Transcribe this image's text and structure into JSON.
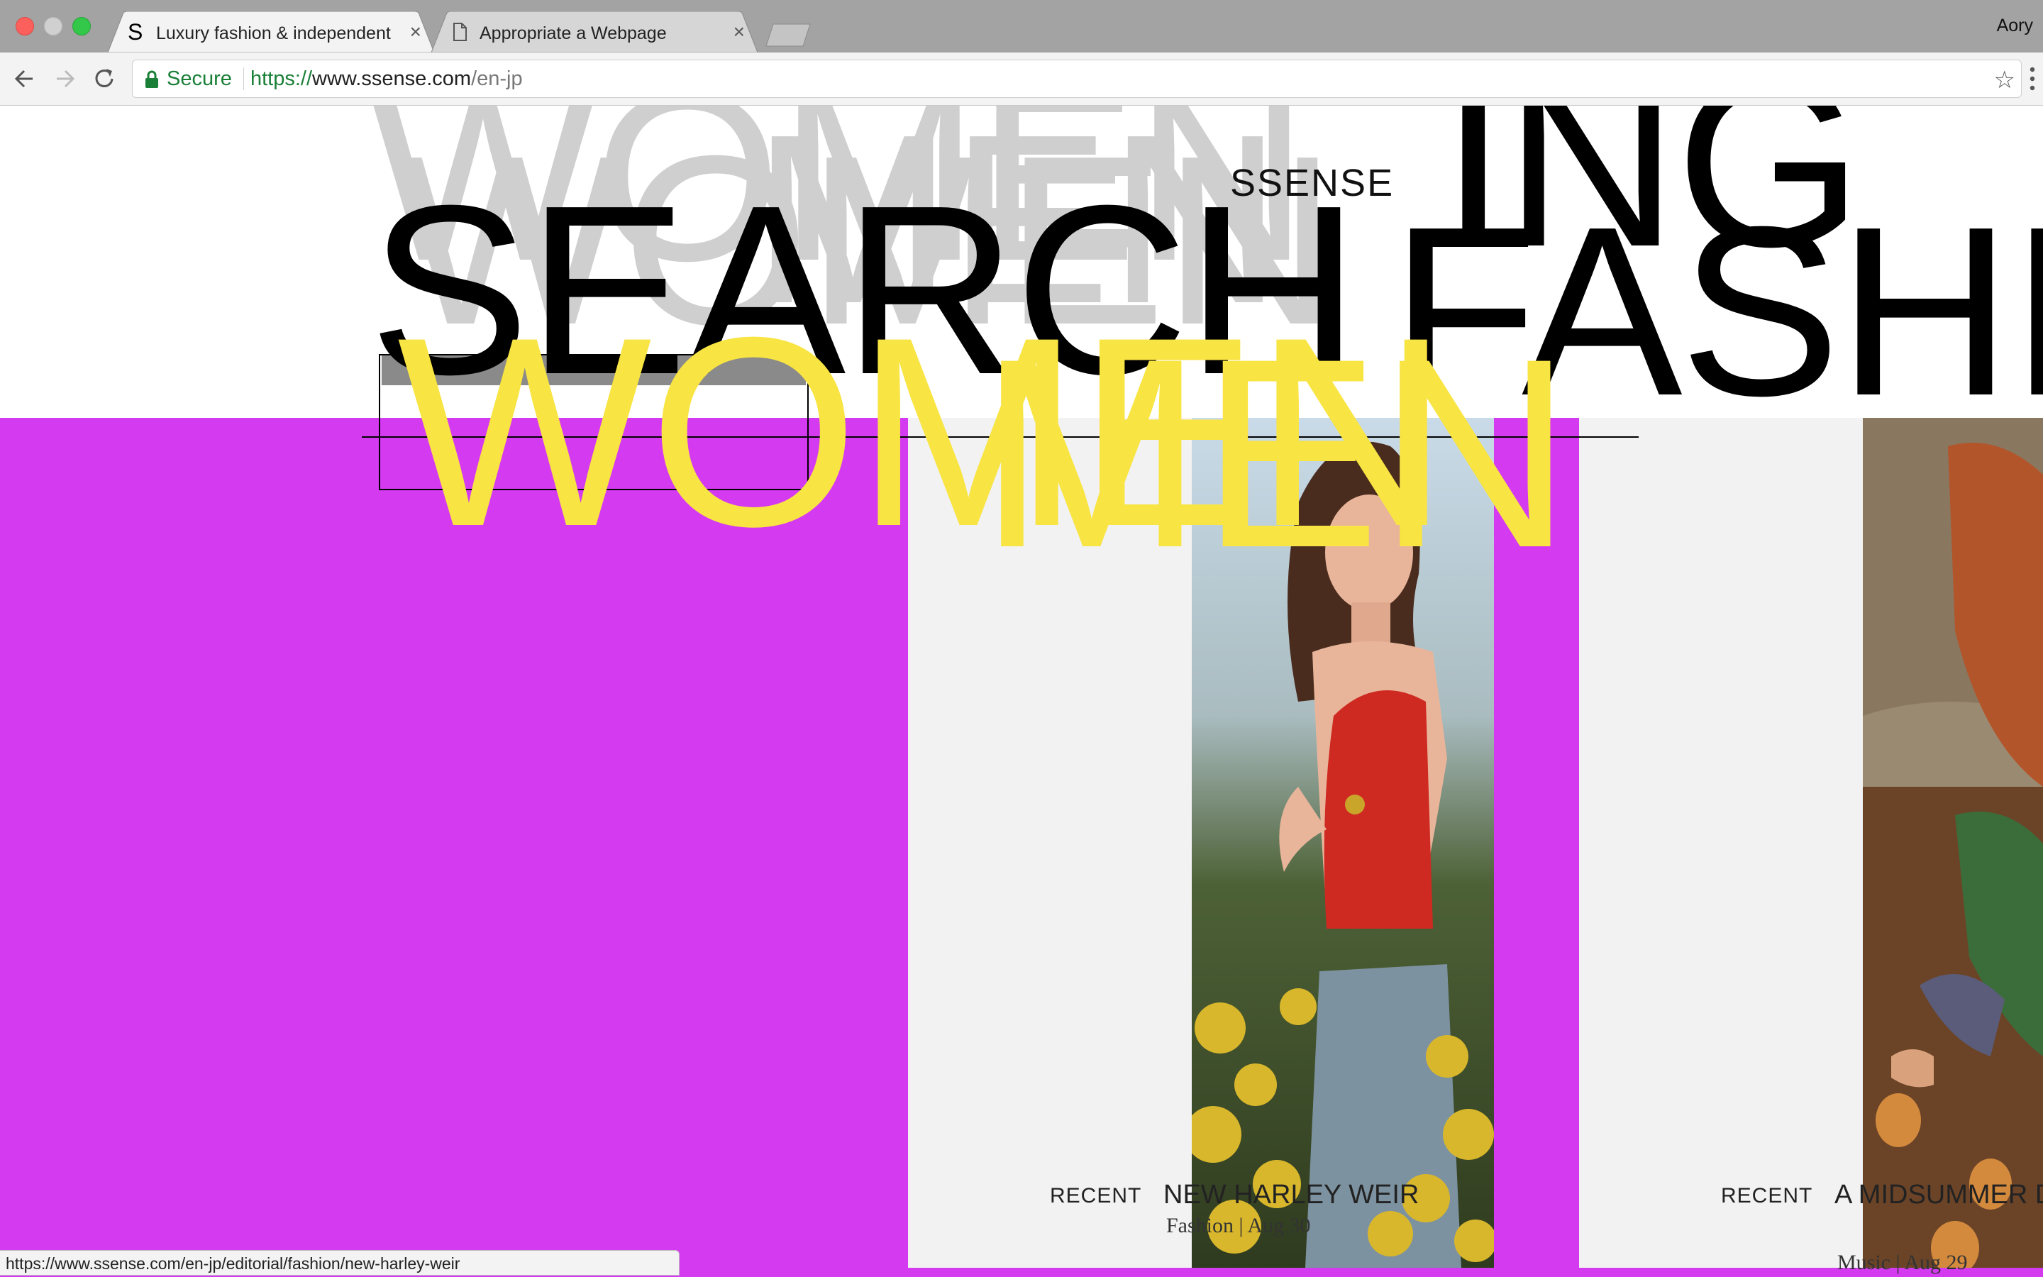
{
  "browser": {
    "tabs": [
      {
        "favicon": "S",
        "title": "Luxury fashion & independent",
        "close": "×"
      },
      {
        "favicon": "page-icon",
        "title": "Appropriate a Webpage",
        "close": "×"
      }
    ],
    "profile": "Aory",
    "address": {
      "secure_label": "Secure",
      "scheme": "https://",
      "host": "www.ssense.com",
      "path": "/en-jp"
    },
    "status_url": "https://www.ssense.com/en-jp/editorial/fashion/new-harley-weir"
  },
  "page": {
    "logo": "SSENSE",
    "overlay_words": {
      "grey_1": "WOMEN",
      "grey_2": "WOMEN",
      "grey_3": "MEN",
      "black_search": "SEARCH",
      "black_fashion": "FASHION",
      "black_ing": "ING",
      "yellow_1": "WOMEN",
      "yellow_2": "MEN"
    },
    "cards": [
      {
        "tag": "RECENT",
        "title": "NEW HARLEY WEIR",
        "category": "Fashion",
        "date": "Aug 30"
      },
      {
        "tag": "RECENT",
        "title": "A MIDSUMMER DREAM WET",
        "category": "Music",
        "date": "Aug 29"
      }
    ]
  },
  "colors": {
    "magenta": "#d43bf0",
    "yellow": "#f8e443",
    "secure_green": "#1a7f37"
  }
}
